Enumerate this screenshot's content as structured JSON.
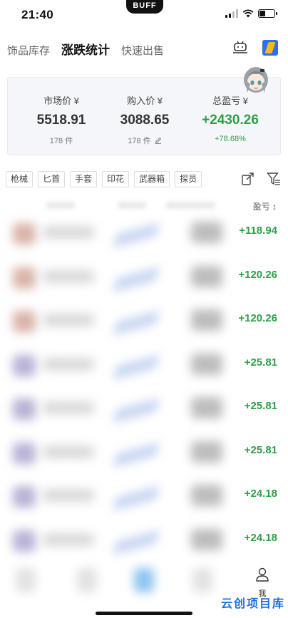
{
  "status_bar": {
    "time": "21:40",
    "island_label": "BUFF",
    "battery_level": 0.4
  },
  "tabs": [
    {
      "label": "饰品库存",
      "active": false
    },
    {
      "label": "涨跌统计",
      "active": true
    },
    {
      "label": "快速出售",
      "active": false
    }
  ],
  "summary": {
    "market": {
      "label": "市场价 ¥",
      "value": "5518.91",
      "count": "178 件"
    },
    "purchase": {
      "label": "购入价 ¥",
      "value": "3088.65",
      "count": "178 件"
    },
    "profit": {
      "label": "总盈亏 ¥",
      "value": "+2430.26",
      "percent": "+78.68%"
    }
  },
  "chips": [
    "枪械",
    "匕首",
    "手套",
    "印花",
    "武器箱",
    "探员"
  ],
  "columns": {
    "profit_label": "盈亏 ↕"
  },
  "rows": [
    {
      "pnl": "+118.94",
      "img_color": "#d9b4a8"
    },
    {
      "pnl": "+120.26",
      "img_color": "#d9b4a8"
    },
    {
      "pnl": "+120.26",
      "img_color": "#d9b4a8"
    },
    {
      "pnl": "+25.81",
      "img_color": "#b9b3d6"
    },
    {
      "pnl": "+25.81",
      "img_color": "#b9b3d6"
    },
    {
      "pnl": "+25.81",
      "img_color": "#b9b3d6"
    },
    {
      "pnl": "+24.18",
      "img_color": "#b9b3d6"
    },
    {
      "pnl": "+24.18",
      "img_color": "#b9b3d6"
    }
  ],
  "bottom_nav": {
    "me_label": "我"
  },
  "watermark": "云创项目库",
  "colors": {
    "profit_green": "#2e9f47",
    "card_bg": "#f4f6fa",
    "brand_blue": "#2f6df6",
    "brand_yellow": "#f7b81c"
  },
  "icons": [
    "robot-icon",
    "buff-brand-icon",
    "edit-pencil-icon",
    "export-icon",
    "filter-icon",
    "user-icon"
  ]
}
